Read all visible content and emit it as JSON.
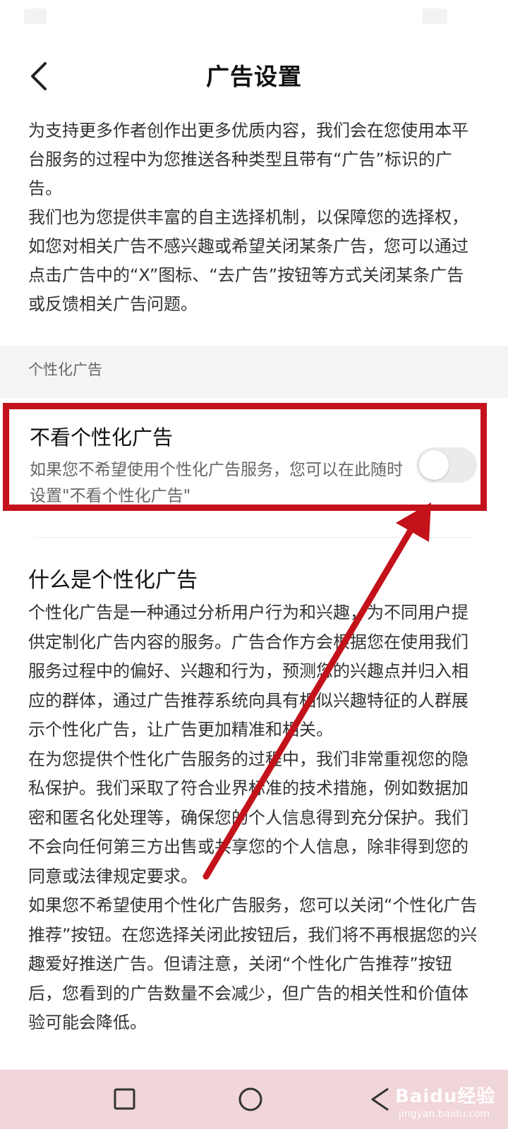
{
  "header": {
    "title": "广告设置"
  },
  "intro": {
    "paragraph1": "为支持更多作者创作出更多优质内容，我们会在您使用本平台服务的过程中为您推送各种类型且带有“广告”标识的广告。",
    "paragraph2": "我们也为您提供丰富的自主选择机制，以保障您的选择权，如您对相关广告不感兴趣或希望关闭某条广告，您可以通过点击广告中的“X”图标、“去广告”按钮等方式关闭某条广告或反馈相关广告问题。"
  },
  "section": {
    "label": "个性化广告"
  },
  "setting": {
    "title": "不看个性化广告",
    "description": "如果您不希望使用个性化广告服务，您可以在此随时设置\"不看个性化广告\"",
    "toggle_on": false
  },
  "what_is": {
    "title": "什么是个性化广告",
    "paragraph1": "个性化广告是一种通过分析用户行为和兴趣，为不同用户提供定制化广告内容的服务。广告合作方会根据您在使用我们服务过程中的偏好、兴趣和行为，预测您的兴趣点并归入相应的群体，通过广告推荐系统向具有相似兴趣特征的人群展示个性化广告，让广告更加精准和相关。",
    "paragraph2": "在为您提供个性化广告服务的过程中，我们非常重视您的隐私保护。我们采取了符合业界标准的技术措施，例如数据加密和匿名化处理等，确保您的个人信息得到充分保护。我们不会向任何第三方出售或共享您的个人信息，除非得到您的同意或法律规定要求。",
    "paragraph3": "如果您不希望使用个性化广告服务，您可以关闭“个性化广告推荐”按钮。在您选择关闭此按钮后，我们将不再根据您的兴趣爱好推送广告。但请注意，关闭“个性化广告推荐”按钮后，您看到的广告数量不会减少，但广告的相关性和价值体验可能会降低。"
  },
  "nav": {
    "recents": "square-icon",
    "home": "circle-icon",
    "back": "triangle-back-icon"
  },
  "watermark": {
    "brand": "Baidu经验",
    "url": "jingyan.baidu.com"
  },
  "colors": {
    "highlight": "#c4121a",
    "nav_bg": "#f0d5d9"
  }
}
